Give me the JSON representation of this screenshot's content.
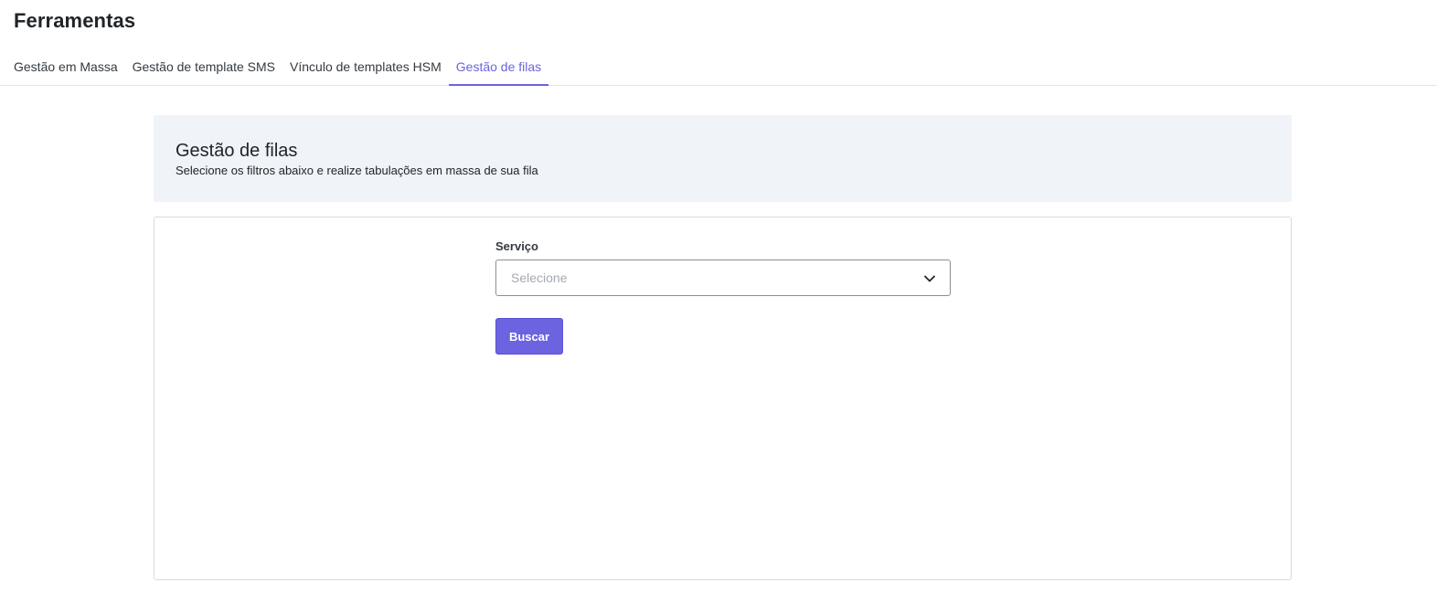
{
  "page": {
    "title": "Ferramentas"
  },
  "tabs": [
    {
      "label": "Gestão em Massa",
      "active": false
    },
    {
      "label": "Gestão de template SMS",
      "active": false
    },
    {
      "label": "Vínculo de templates HSM",
      "active": false
    },
    {
      "label": "Gestão de filas",
      "active": true
    }
  ],
  "header_panel": {
    "title": "Gestão de filas",
    "subtitle": "Selecione os filtros abaixo e realize tabulações em massa de sua fila"
  },
  "form": {
    "service_label": "Serviço",
    "service_placeholder": "Selecione",
    "search_button_label": "Buscar"
  },
  "icons": {
    "select_chevron": "chevron-down-icon"
  },
  "colors": {
    "accent": "#6c63e0",
    "header_bg": "#f0f3f7",
    "border": "#d7dadf"
  }
}
